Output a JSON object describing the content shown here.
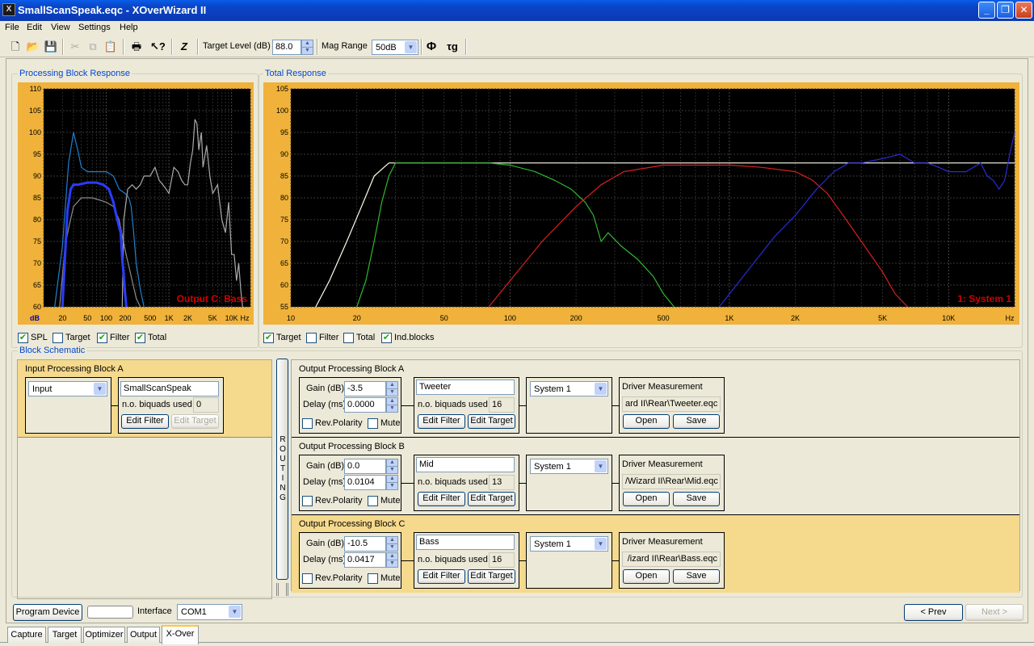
{
  "window": {
    "title": "SmallScanSpeak.eqc - XOverWizard II",
    "icon": "xover-app-icon"
  },
  "menu": [
    "File",
    "Edit",
    "View",
    "Settings",
    "Help"
  ],
  "toolbar": {
    "target_label": "Target Level (dB)",
    "target_value": "88.0",
    "magrange_label": "Mag Range",
    "magrange_value": "50dB",
    "icons": [
      "new-file-icon",
      "open-folder-icon",
      "save-icon",
      "cut-icon",
      "copy-icon",
      "paste-icon",
      "print-icon",
      "help-pointer-icon",
      "impedance-icon",
      "phase-icon",
      "group-delay-icon"
    ]
  },
  "left_panel": {
    "title": "Processing Block Response",
    "overlay": "Output C: Bass",
    "checks": [
      {
        "label": "SPL",
        "checked": true
      },
      {
        "label": "Target",
        "checked": false
      },
      {
        "label": "Filter",
        "checked": true
      },
      {
        "label": "Total",
        "checked": true
      }
    ]
  },
  "right_panel": {
    "title": "Total Response",
    "overlay": "1: System 1",
    "checks": [
      {
        "label": "Target",
        "checked": true
      },
      {
        "label": "Filter",
        "checked": false
      },
      {
        "label": "Total",
        "checked": false
      },
      {
        "label": "Ind.blocks",
        "checked": true
      }
    ]
  },
  "chart_data": [
    {
      "type": "line",
      "title": "Processing Block Response",
      "ylabel": "dB",
      "xlabel": "Hz",
      "xscale": "log",
      "xlim": [
        10,
        20000
      ],
      "ylim": [
        60,
        110
      ],
      "yticks": [
        "110",
        "105",
        "100",
        "95",
        "90",
        "85",
        "80",
        "75",
        "70",
        "65",
        "60"
      ],
      "xticks": [
        {
          "v": 20,
          "t": "20"
        },
        {
          "v": 50,
          "t": "50"
        },
        {
          "v": 100,
          "t": "100"
        },
        {
          "v": 200,
          "t": "200"
        },
        {
          "v": 500,
          "t": "500"
        },
        {
          "v": 1000,
          "t": "1K"
        },
        {
          "v": 2000,
          "t": "2K"
        },
        {
          "v": 5000,
          "t": "5K"
        },
        {
          "v": 10000,
          "t": "10K"
        }
      ],
      "series": [
        {
          "color": "#1e7fd0",
          "points": [
            [
              15,
              60
            ],
            [
              20,
              74
            ],
            [
              25,
              93
            ],
            [
              30,
              100
            ],
            [
              35,
              96
            ],
            [
              40,
              92
            ],
            [
              50,
              91
            ],
            [
              70,
              91
            ],
            [
              100,
              91
            ],
            [
              130,
              90
            ],
            [
              160,
              87
            ],
            [
              200,
              86
            ],
            [
              230,
              85
            ],
            [
              250,
              83
            ],
            [
              270,
              78
            ],
            [
              300,
              70
            ],
            [
              350,
              64
            ],
            [
              400,
              60
            ]
          ]
        },
        {
          "color": "#8c8c8c",
          "points": [
            [
              18,
              60
            ],
            [
              22,
              74
            ],
            [
              25,
              78
            ],
            [
              30,
              83
            ],
            [
              40,
              85
            ],
            [
              60,
              85
            ],
            [
              100,
              84
            ],
            [
              130,
              83
            ],
            [
              160,
              80
            ],
            [
              200,
              73
            ],
            [
              250,
              67
            ],
            [
              300,
              62
            ],
            [
              350,
              60
            ]
          ]
        },
        {
          "color": "#aaaaaa",
          "points": [
            [
              180,
              60
            ],
            [
              190,
              80
            ],
            [
              220,
              87
            ],
            [
              260,
              88
            ],
            [
              300,
              87
            ],
            [
              350,
              88
            ],
            [
              400,
              90
            ],
            [
              500,
              90
            ],
            [
              600,
              92
            ],
            [
              700,
              89
            ],
            [
              800,
              88
            ],
            [
              900,
              87
            ],
            [
              1000,
              86
            ],
            [
              1200,
              92
            ],
            [
              1400,
              91
            ],
            [
              1600,
              89
            ],
            [
              1800,
              88
            ],
            [
              2000,
              88
            ],
            [
              2200,
              93
            ],
            [
              2400,
              96
            ],
            [
              2600,
              103
            ],
            [
              2800,
              102
            ],
            [
              3000,
              96
            ],
            [
              3300,
              100
            ],
            [
              3500,
              92
            ],
            [
              4000,
              97
            ],
            [
              4500,
              90
            ],
            [
              5000,
              86
            ],
            [
              6000,
              88
            ],
            [
              7000,
              80
            ],
            [
              8000,
              77
            ],
            [
              9000,
              84
            ],
            [
              10000,
              72
            ],
            [
              11000,
              72
            ],
            [
              12000,
              66
            ],
            [
              13000,
              70
            ],
            [
              14000,
              64
            ],
            [
              15000,
              60
            ]
          ]
        },
        {
          "color": "#2a3cff",
          "points": [
            [
              20,
              60
            ],
            [
              22,
              72
            ],
            [
              24,
              82
            ],
            [
              27,
              87
            ],
            [
              30,
              88
            ],
            [
              35,
              88
            ],
            [
              50,
              88.5
            ],
            [
              70,
              88.5
            ],
            [
              90,
              88
            ],
            [
              110,
              87
            ],
            [
              130,
              84
            ],
            [
              150,
              80
            ],
            [
              170,
              77
            ],
            [
              180,
              71
            ],
            [
              190,
              67
            ],
            [
              200,
              63
            ],
            [
              210,
              60
            ]
          ]
        }
      ]
    },
    {
      "type": "line",
      "title": "Total Response",
      "xscale": "log",
      "xlim": [
        10,
        20000
      ],
      "ylim": [
        55,
        105
      ],
      "xlabel": "Hz",
      "yticks": [
        "105",
        "100",
        "95",
        "90",
        "85",
        "80",
        "75",
        "70",
        "65",
        "60",
        "55"
      ],
      "xticks": [
        {
          "v": 10,
          "t": "10"
        },
        {
          "v": 20,
          "t": "20"
        },
        {
          "v": 50,
          "t": "50"
        },
        {
          "v": 100,
          "t": "100"
        },
        {
          "v": 200,
          "t": "200"
        },
        {
          "v": 500,
          "t": "500"
        },
        {
          "v": 1000,
          "t": "1K"
        },
        {
          "v": 2000,
          "t": "2K"
        },
        {
          "v": 5000,
          "t": "5K"
        },
        {
          "v": 10000,
          "t": "10K"
        }
      ],
      "series": [
        {
          "color": "#ffffee",
          "points": [
            [
              13,
              55
            ],
            [
              15,
              61
            ],
            [
              18,
              70
            ],
            [
              21,
              78
            ],
            [
              24,
              85
            ],
            [
              28,
              88
            ],
            [
              35,
              88
            ],
            [
              100,
              88
            ],
            [
              1000,
              88
            ],
            [
              20000,
              88
            ]
          ]
        },
        {
          "color": "#2eb82e",
          "points": [
            [
              20,
              55
            ],
            [
              22,
              61
            ],
            [
              24,
              70
            ],
            [
              26,
              79
            ],
            [
              28,
              85
            ],
            [
              30,
              88
            ],
            [
              50,
              88
            ],
            [
              80,
              88
            ],
            [
              100,
              87.5
            ],
            [
              130,
              86
            ],
            [
              160,
              84
            ],
            [
              190,
              82
            ],
            [
              220,
              79
            ],
            [
              240,
              76
            ],
            [
              260,
              70
            ],
            [
              280,
              72
            ],
            [
              320,
              69
            ],
            [
              380,
              66
            ],
            [
              450,
              62
            ],
            [
              500,
              58
            ],
            [
              560,
              55
            ]
          ]
        },
        {
          "color": "#d62020",
          "points": [
            [
              80,
              55
            ],
            [
              100,
              61
            ],
            [
              140,
              70
            ],
            [
              200,
              78
            ],
            [
              260,
              83
            ],
            [
              330,
              86
            ],
            [
              500,
              87.5
            ],
            [
              1000,
              87.5
            ],
            [
              1400,
              87
            ],
            [
              2000,
              86
            ],
            [
              2400,
              84
            ],
            [
              2800,
              81
            ],
            [
              3300,
              76
            ],
            [
              4000,
              70
            ],
            [
              5000,
              63
            ],
            [
              5700,
              58
            ],
            [
              6500,
              55
            ]
          ]
        },
        {
          "color": "#2a2ad8",
          "points": [
            [
              900,
              55
            ],
            [
              1200,
              63
            ],
            [
              1600,
              71
            ],
            [
              2000,
              76
            ],
            [
              2500,
              82
            ],
            [
              3000,
              86
            ],
            [
              3500,
              88
            ],
            [
              4000,
              88
            ],
            [
              5000,
              89
            ],
            [
              6000,
              90
            ],
            [
              7000,
              88
            ],
            [
              8000,
              88
            ],
            [
              9000,
              87
            ],
            [
              10000,
              86
            ],
            [
              12000,
              86
            ],
            [
              14000,
              88
            ],
            [
              15000,
              85
            ],
            [
              16000,
              84
            ],
            [
              17000,
              82
            ],
            [
              18000,
              84
            ],
            [
              19000,
              90
            ],
            [
              20000,
              95
            ]
          ]
        }
      ]
    }
  ],
  "schematic": {
    "title": "Block Schematic",
    "routing": "ROUTING",
    "input": {
      "title": "Input Processing Block A",
      "source": "Input",
      "filter_name": "SmallScanSpeak",
      "biquads_label": "n.o. biquads used",
      "biquads": "0",
      "edit_filter": "Edit Filter",
      "edit_target": "Edit Target"
    },
    "outputs": [
      {
        "title": "Output Processing Block A",
        "gain_label": "Gain (dB)",
        "gain": "-3.5",
        "delay_label": "Delay (ms)",
        "delay": "0.0000",
        "rev_label": "Rev.Polarity",
        "mute_label": "Mute",
        "filter_name": "Tweeter",
        "biquads_label": "n.o. biquads used",
        "biquads": "16",
        "edit_filter": "Edit Filter",
        "edit_target": "Edit Target",
        "system": "System 1",
        "dm_title": "Driver Measurement",
        "dm_path": "ard II\\Rear\\Tweeter.eqc",
        "open": "Open",
        "save": "Save"
      },
      {
        "title": "Output Processing Block B",
        "gain_label": "Gain (dB)",
        "gain": "0.0",
        "delay_label": "Delay (ms)",
        "delay": "0.0104",
        "rev_label": "Rev.Polarity",
        "mute_label": "Mute",
        "filter_name": "Mid",
        "biquads_label": "n.o. biquads used",
        "biquads": "13",
        "edit_filter": "Edit Filter",
        "edit_target": "Edit Target",
        "system": "System 1",
        "dm_title": "Driver Measurement",
        "dm_path": "/Wizard II\\Rear\\Mid.eqc",
        "open": "Open",
        "save": "Save"
      },
      {
        "title": "Output Processing Block C",
        "gain_label": "Gain (dB)",
        "gain": "-10.5",
        "delay_label": "Delay (ms)",
        "delay": "0.0417",
        "rev_label": "Rev.Polarity",
        "mute_label": "Mute",
        "filter_name": "Bass",
        "biquads_label": "n.o. biquads used",
        "biquads": "16",
        "edit_filter": "Edit Filter",
        "edit_target": "Edit Target",
        "system": "System 1",
        "dm_title": "Driver Measurement",
        "dm_path": "/izard II\\Rear\\Bass.eqc",
        "open": "Open",
        "save": "Save"
      }
    ]
  },
  "bottom": {
    "program": "Program Device",
    "interface_label": "Interface",
    "interface": "COM1",
    "prev": "< Prev",
    "next": "Next >"
  },
  "tabs": [
    "Capture",
    "Target",
    "Optimizer",
    "Output",
    "X-Over"
  ],
  "active_tab": "X-Over",
  "colors": {
    "title_bar": "#0a46c8",
    "plot_frame": "#f0b23a",
    "selected_block": "#f5d98c",
    "label_blue": "#0046d5",
    "overlay_red": "#d00000"
  }
}
